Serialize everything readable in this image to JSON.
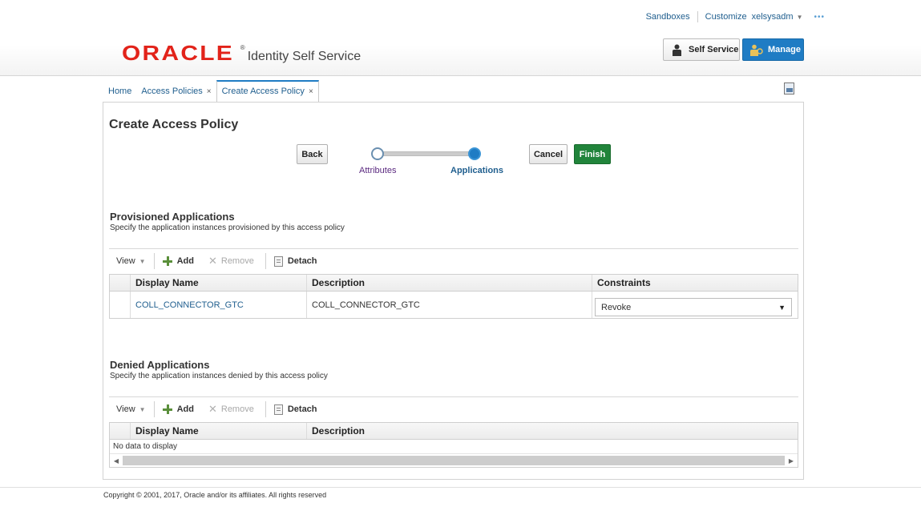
{
  "header": {
    "links": [
      "Sandboxes",
      "Customize"
    ],
    "user": "xelsysadm",
    "more": "•••",
    "logo_word": "ORACLE",
    "logo_registered": "®",
    "product": "Identity Self Service",
    "self_service_label": "Self Service",
    "manage_label": "Manage"
  },
  "tabs": [
    {
      "label": "Home"
    },
    {
      "label": "Access Policies",
      "close": "×"
    },
    {
      "label": "Create Access Policy",
      "close": "×"
    }
  ],
  "page": {
    "title": "Create Access Policy",
    "back_label": "Back",
    "cancel_label": "Cancel",
    "finish_label": "Finish",
    "train": {
      "step1": "Attributes",
      "step2": "Applications"
    }
  },
  "provisioned": {
    "title": "Provisioned Applications",
    "desc": "Specify the application instances provisioned by this access policy",
    "toolbar": {
      "view": "View",
      "add": "Add",
      "remove": "Remove",
      "detach": "Detach"
    },
    "columns": [
      "Display Name",
      "Description",
      "Constraints"
    ],
    "rows": [
      {
        "display_name": "COLL_CONNECTOR_GTC",
        "description": "COLL_CONNECTOR_GTC",
        "constraint": "Revoke"
      }
    ]
  },
  "denied": {
    "title": "Denied Applications",
    "desc": "Specify the application instances denied by this access policy",
    "toolbar": {
      "view": "View",
      "add": "Add",
      "remove": "Remove",
      "detach": "Detach"
    },
    "columns": [
      "Display Name",
      "Description"
    ],
    "empty": "No data to display"
  },
  "footer": "Copyright © 2001, 2017, Oracle and/or its affiliates. All rights reserved",
  "colors": {
    "accent": "#1f7cc4",
    "finish": "#21843b",
    "oracle_red": "#e2231a",
    "link": "#1f5e8e"
  }
}
